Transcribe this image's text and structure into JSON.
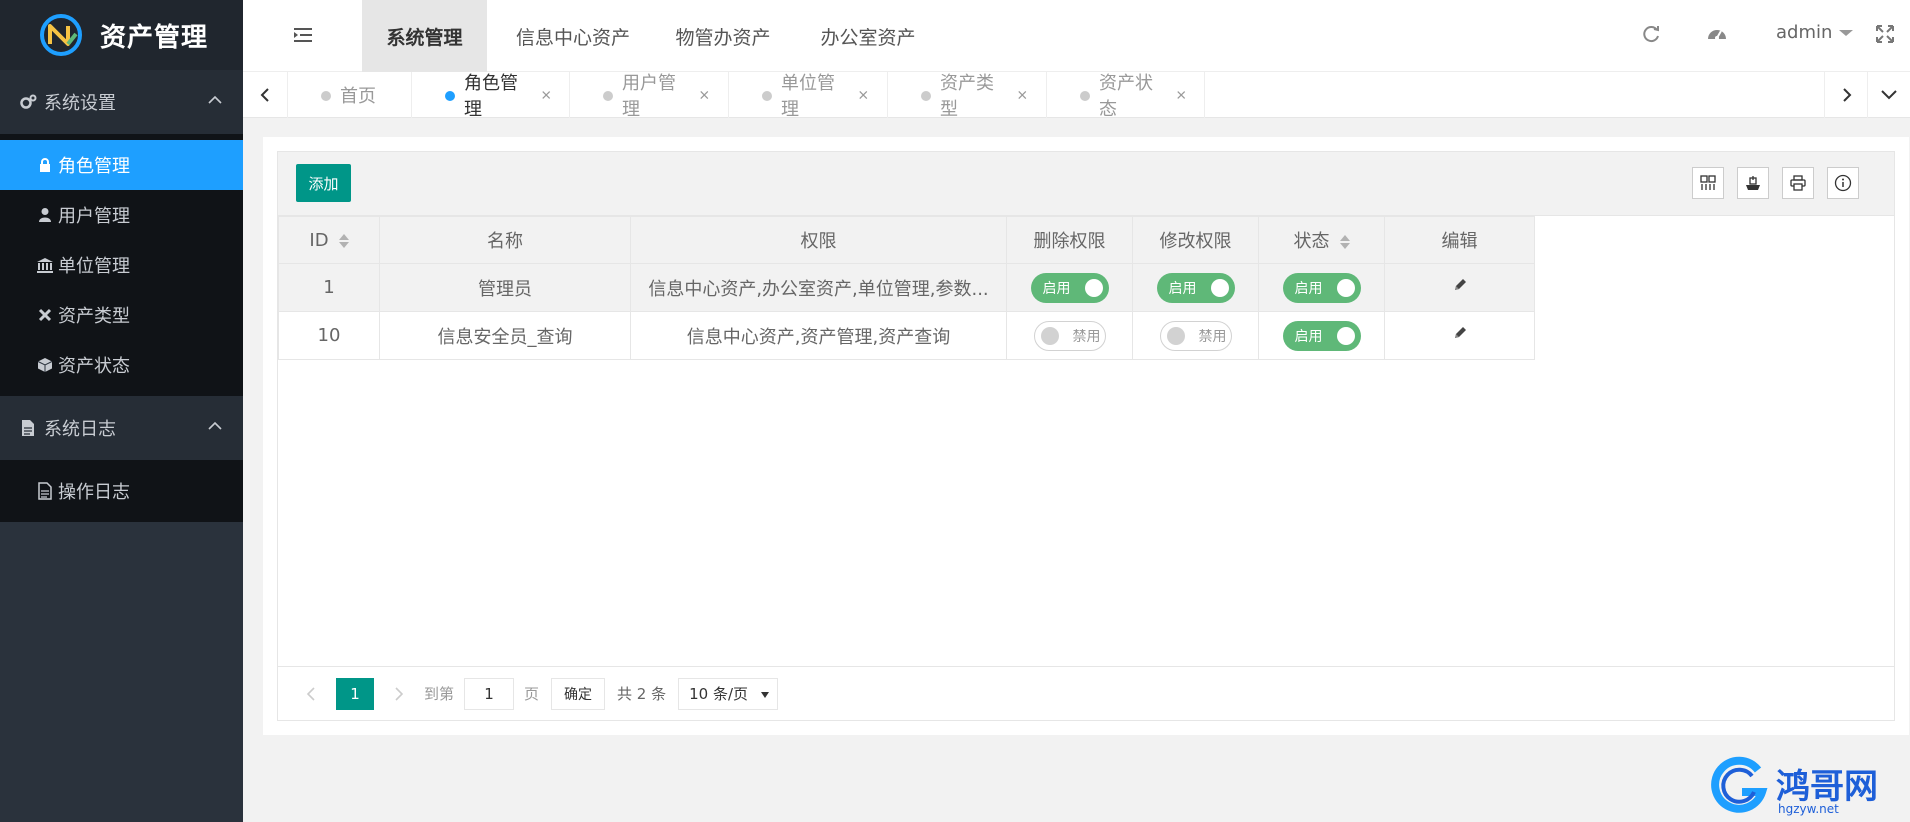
{
  "app": {
    "title": "资产管理"
  },
  "sidebar": {
    "groups": [
      {
        "label": "系统设置",
        "icon": "gears-icon",
        "items": [
          {
            "label": "角色管理",
            "icon": "lock-icon",
            "active": true
          },
          {
            "label": "用户管理",
            "icon": "user-icon",
            "active": false
          },
          {
            "label": "单位管理",
            "icon": "bank-icon",
            "active": false
          },
          {
            "label": "资产类型",
            "icon": "joomla-icon",
            "active": false
          },
          {
            "label": "资产状态",
            "icon": "cube-icon",
            "active": false
          }
        ]
      },
      {
        "label": "系统日志",
        "icon": "file-icon",
        "items": [
          {
            "label": "操作日志",
            "icon": "file-text-icon",
            "active": false
          }
        ]
      }
    ]
  },
  "header": {
    "tabs": [
      "系统管理",
      "信息中心资产",
      "物管办资产",
      "办公室资产"
    ],
    "active_tab": 0,
    "user": "admin"
  },
  "tabbar": {
    "tabs": [
      "首页",
      "角色管理",
      "用户管理",
      "单位管理",
      "资产类型",
      "资产状态"
    ],
    "active": 1
  },
  "toolbar": {
    "add_label": "添加"
  },
  "table": {
    "columns": [
      "ID",
      "名称",
      "权限",
      "删除权限",
      "修改权限",
      "状态",
      "编辑"
    ],
    "rows": [
      {
        "id": "1",
        "name": "管理员",
        "perm": "信息中心资产,办公室资产,单位管理,参数...",
        "del": "启用",
        "mod": "启用",
        "status": "启用"
      },
      {
        "id": "10",
        "name": "信息安全员_查询",
        "perm": "信息中心资产,资产管理,资产查询",
        "del": "禁用",
        "mod": "禁用",
        "status": "启用"
      }
    ]
  },
  "pager": {
    "current": "1",
    "goto_label": "到第",
    "goto_value": "1",
    "page_label": "页",
    "ok_label": "确定",
    "total_label": "共 2 条",
    "size_label": "10 条/页"
  },
  "watermark": {
    "text": "鸿哥网",
    "sub": "hgzyw.net"
  },
  "colors": {
    "primary": "#009688",
    "accent": "#1e9fff",
    "switch_on": "#5fb878",
    "sidebar": "#2a323c"
  }
}
